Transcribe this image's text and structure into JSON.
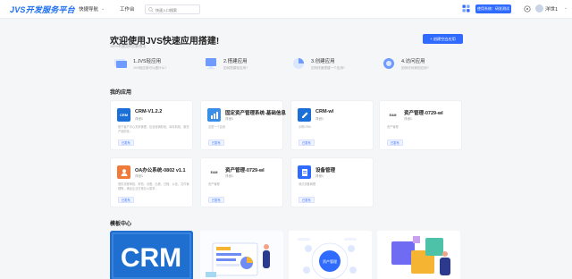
{
  "header": {
    "logo_text": "JVS开发服务平台",
    "nav_quick": "快捷导航",
    "nav_workbench": "工作台",
    "search_placeholder": "快速入口搜索",
    "env_badge": "使用系统：研发测试",
    "user_name": "洋世1"
  },
  "welcome": {
    "title": "欢迎使用JVS快速应用搭建!",
    "subtitle": "100%构建您的创新想法",
    "create_button": "+ 创建空白应用"
  },
  "steps": [
    {
      "title": "1.JVS轻应用",
      "desc": "JVS轻应用可以做什么?"
    },
    {
      "title": "2.搭建应用",
      "desc": "如何搭建轻应用?"
    },
    {
      "title": "3.创建应用",
      "desc": "如何快速搭建一个应用?"
    },
    {
      "title": "4.访问应用",
      "desc": "如何访问我的应用?"
    }
  ],
  "sections": {
    "my_apps": "我的应用",
    "templates": "模板中心"
  },
  "apps": [
    {
      "title": "CRM-V1.2.2",
      "owner": "洋世1",
      "desc": "基于客户中心关系管理，包含营销阶段、库存阶段、服务产品阶段...",
      "tag": "已发布",
      "logo": "CRM",
      "color": "#1b6fd6"
    },
    {
      "title": "固定资产管理系统-基础信息",
      "owner": "洋世1",
      "desc": "这是一个应用",
      "tag": "已发布",
      "logo": "chart",
      "color": "#3a8ee8"
    },
    {
      "title": "CRM-wl",
      "owner": "洋世1",
      "desc": "示例CRM",
      "tag": "已发布",
      "logo": "edit",
      "color": "#1b6fd6"
    },
    {
      "title": "资产管理-0729-wl",
      "owner": "洋世1",
      "desc": "资产管理",
      "tag": "已发布",
      "logo": "EAM",
      "color": "#ffffff"
    },
    {
      "title": "OA办公系统-0802 v1.1",
      "owner": "洋世1",
      "desc": "提供流程审批、考勤、请假、出差、日程、公告、文件管理等，满足企业日常办公需求...",
      "tag": "已发布",
      "logo": "person",
      "color": "#f07a3a"
    },
    {
      "title": "资产管理-0729-wl",
      "owner": "洋世1",
      "desc": "资产管理",
      "tag": "已发布",
      "logo": "EAM",
      "color": "#ffffff"
    },
    {
      "title": "设备管理",
      "owner": "洋世1",
      "desc": "测试设备管理",
      "tag": "已发布",
      "logo": "doc",
      "color": "#2f6bff"
    }
  ],
  "templates": [
    {
      "label": "CRM"
    },
    {
      "label": ""
    },
    {
      "label": "资产管理"
    },
    {
      "label": ""
    }
  ],
  "colors": {
    "accent": "#2f6bff",
    "logo": "#1d6ff2"
  }
}
